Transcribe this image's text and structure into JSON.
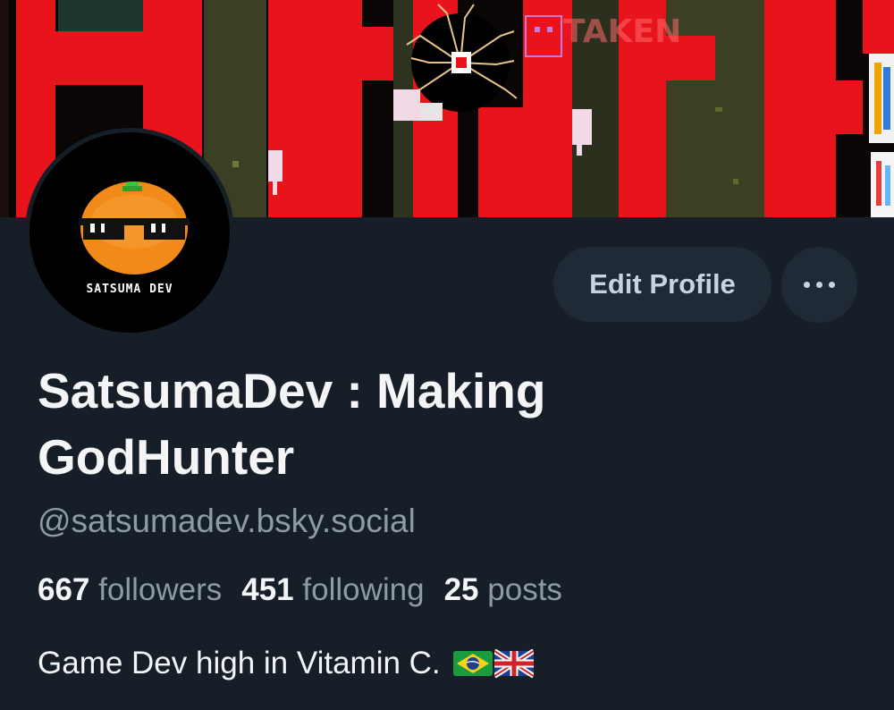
{
  "banner": {
    "watermark": "TAKEN",
    "colors": {
      "red": "#e8131b",
      "dark": "#0a0606",
      "moss": "#4a4f2e"
    }
  },
  "avatar": {
    "caption": "SATSUMA DEV",
    "colors": {
      "orange": "#f28a1a",
      "leaf": "#38c43c",
      "background": "#000000"
    }
  },
  "actions": {
    "edit_profile_label": "Edit Profile",
    "more_icon": "ellipsis-horizontal-icon"
  },
  "profile": {
    "display_name": "SatsumaDev : Making GodHunter",
    "handle": "@satsumadev.bsky.social",
    "bio": "Game Dev high in Vitamin C.",
    "bio_flags": [
      "brazil-flag-icon",
      "uk-flag-icon"
    ]
  },
  "stats": {
    "followers_count": "667",
    "followers_label": "followers",
    "following_count": "451",
    "following_label": "following",
    "posts_count": "25",
    "posts_label": "posts"
  },
  "theme": {
    "background": "#161e27",
    "button_bg": "#1f2a36",
    "text_primary": "#f3f5f7",
    "text_secondary": "#8d9aa8"
  }
}
